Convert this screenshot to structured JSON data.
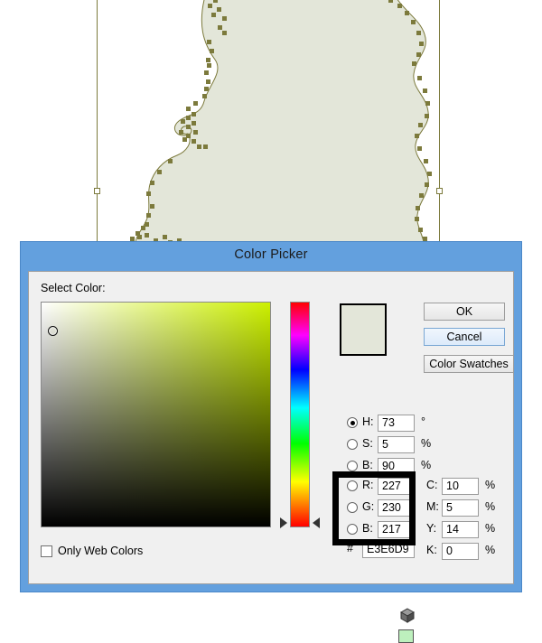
{
  "canvas": {
    "artwork_fill": "#e3e6d9",
    "path_stroke": "#7c7a3c",
    "background": "#ffffff"
  },
  "dialog": {
    "title": "Color Picker",
    "titlebar_color": "#63a0de",
    "select_color_label": "Select Color:",
    "buttons": {
      "ok": "OK",
      "cancel": "Cancel",
      "color_swatches": "Color Swatches"
    },
    "preview": {
      "current_color": "#e3e6d9",
      "websafe_color": "#bdf0bd",
      "gamut_icon": "cube-icon",
      "websafe_icon": "websafe-swatch-icon"
    },
    "hsb": {
      "selected": "H",
      "rows": [
        {
          "name": "H",
          "label": "H:",
          "value": "73",
          "unit": "°",
          "checked": true
        },
        {
          "name": "S",
          "label": "S:",
          "value": "5",
          "unit": "%",
          "checked": false
        },
        {
          "name": "B",
          "label": "B:",
          "value": "90",
          "unit": "%",
          "checked": false
        }
      ]
    },
    "rgb": {
      "rows": [
        {
          "name": "R",
          "label": "R:",
          "value": "227",
          "checked": false
        },
        {
          "name": "G",
          "label": "G:",
          "value": "230",
          "checked": false
        },
        {
          "name": "B",
          "label": "B:",
          "value": "217",
          "checked": false
        }
      ]
    },
    "cmyk": {
      "rows": [
        {
          "name": "C",
          "label": "C:",
          "value": "10",
          "unit": "%"
        },
        {
          "name": "M",
          "label": "M:",
          "value": "5",
          "unit": "%"
        },
        {
          "name": "Y",
          "label": "Y:",
          "value": "14",
          "unit": "%"
        },
        {
          "name": "K",
          "label": "K:",
          "value": "0",
          "unit": "%"
        }
      ]
    },
    "hex": {
      "hash": "#",
      "value": "E3E6D9"
    },
    "only_web_colors": {
      "label": "Only Web Colors",
      "checked": false
    }
  }
}
